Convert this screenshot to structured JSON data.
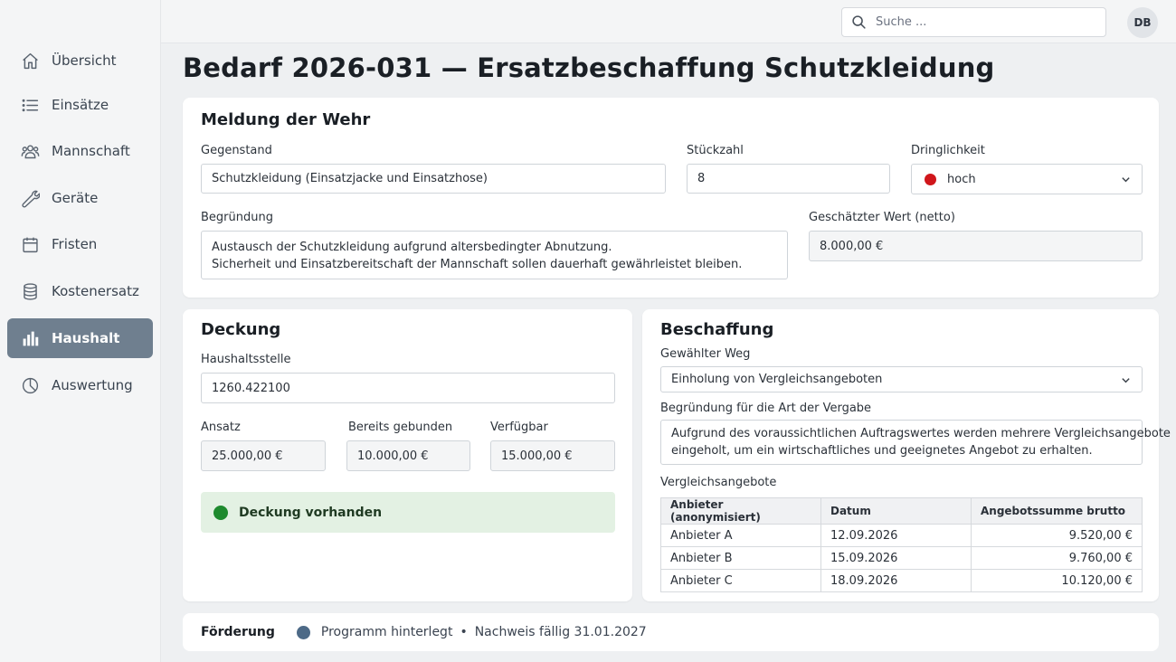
{
  "sidebar": {
    "items": [
      {
        "label": "Übersicht",
        "icon": "home-icon"
      },
      {
        "label": "Einsätze",
        "icon": "list-icon"
      },
      {
        "label": "Mannschaft",
        "icon": "users-icon"
      },
      {
        "label": "Geräte",
        "icon": "wrench-icon"
      },
      {
        "label": "Fristen",
        "icon": "calendar-icon"
      },
      {
        "label": "Kostenersatz",
        "icon": "database-icon"
      },
      {
        "label": "Haushalt",
        "icon": "bar-chart-icon",
        "active": true
      },
      {
        "label": "Auswertung",
        "icon": "pie-chart-icon"
      }
    ]
  },
  "topbar": {
    "search_placeholder": "Suche ...",
    "avatar_initials": "DB"
  },
  "page": {
    "title": "Bedarf 2026-031 — Ersatzbeschaffung Schutzkleidung"
  },
  "meldung": {
    "title": "Meldung der Wehr",
    "gegenstand_label": "Gegenstand",
    "gegenstand_value": "Schutzkleidung (Einsatzjacke und Einsatzhose)",
    "stueckzahl_label": "Stückzahl",
    "stueckzahl_value": "8",
    "dringlichkeit_label": "Dringlichkeit",
    "dringlichkeit_value": "hoch",
    "dringlichkeit_color": "#d0161b",
    "begruendung_label": "Begründung",
    "begruendung_line1": "Austausch der Schutzkleidung aufgrund altersbedingter Abnutzung.",
    "begruendung_line2": "Sicherheit und Einsatzbereitschaft der Mannschaft sollen dauerhaft gewährleistet bleiben.",
    "wert_label": "Geschätzter Wert (netto)",
    "wert_value": "8.000,00 €"
  },
  "deckung": {
    "title": "Deckung",
    "haushaltsstelle_label": "Haushaltsstelle",
    "haushaltsstelle_value": "1260.422100",
    "ansatz_label": "Ansatz",
    "ansatz_value": "25.000,00 €",
    "gebunden_label": "Bereits gebunden",
    "gebunden_value": "10.000,00 €",
    "verfuegbar_label": "Verfügbar",
    "verfuegbar_value": "15.000,00 €",
    "status_text": "Deckung vorhanden",
    "status_color": "#1e8a2e"
  },
  "beschaffung": {
    "title": "Beschaffung",
    "weg_label": "Gewählter Weg",
    "weg_value": "Einholung von Vergleichsangeboten",
    "begruendung_label": "Begründung für die Art der Vergabe",
    "begruendung_line1": "Aufgrund des voraussichtlichen Auftragswertes werden mehrere Vergleichsangebote",
    "begruendung_line2": "eingeholt, um ein wirtschaftliches und geeignetes Angebot zu erhalten.",
    "angebote_label": "Vergleichsangebote",
    "columns": [
      "Anbieter (anonymisiert)",
      "Datum",
      "Angebotssumme brutto"
    ],
    "rows": [
      [
        "Anbieter A",
        "12.09.2026",
        "9.520,00 €"
      ],
      [
        "Anbieter B",
        "15.09.2026",
        "9.760,00 €"
      ],
      [
        "Anbieter C",
        "18.09.2026",
        "10.120,00 €"
      ]
    ]
  },
  "foerderung": {
    "title": "Förderung",
    "status_color": "#4d6a87",
    "text1": "Programm hinterlegt",
    "separator": "•",
    "text2": "Nachweis fällig 31.01.2027"
  }
}
